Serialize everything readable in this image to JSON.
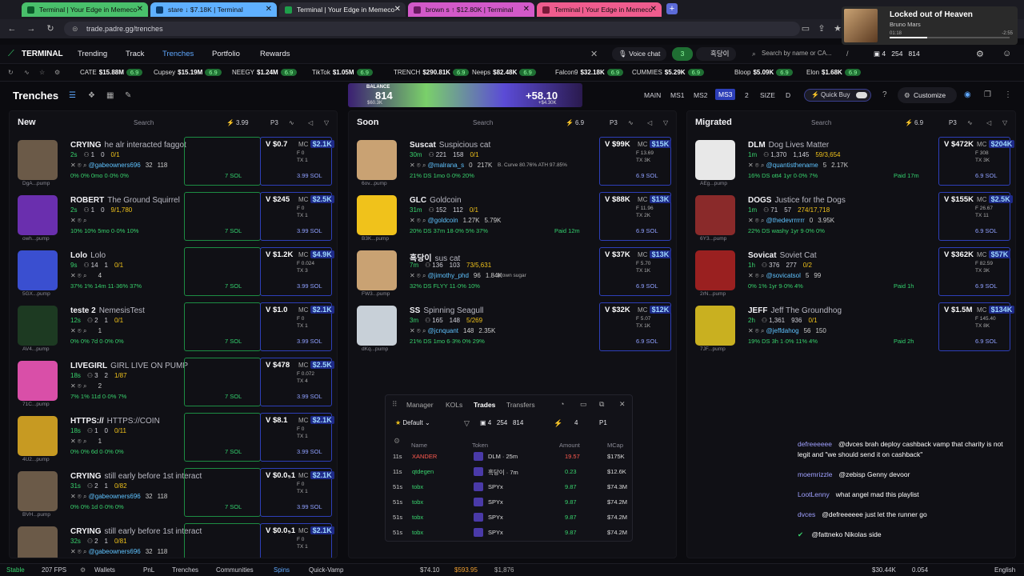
{
  "browser": {
    "tabs": [
      {
        "label": "Terminal | Your Edge in Memeco"
      },
      {
        "label": "stare ↓ $7.18K | Terminal"
      },
      {
        "label": "Terminal | Your Edge in Memeco"
      },
      {
        "label": "brown s ↑ $12.80K | Terminal"
      },
      {
        "label": "Terminal | Your Edge in Memeco"
      }
    ],
    "url": "trade.padre.gg/trenches"
  },
  "music": {
    "title": "Locked out of Heaven",
    "artist": "Bruno Mars",
    "elapsed": "01:18",
    "remaining": "-2:55"
  },
  "nav": {
    "brand": "TERMINAL",
    "links": [
      "Trending",
      "Track",
      "Trenches",
      "Portfolio",
      "Rewards"
    ],
    "voice_chat": "Voice chat",
    "badge_count": "3",
    "profile_name": "흑당이",
    "search_placeholder": "Search by name or CA...",
    "slash": "/",
    "wallet_count": "4",
    "val1": "254",
    "val2": "814"
  },
  "ticker": [
    {
      "name": "CATE",
      "mc": "$15.88M",
      "pct": "6.9"
    },
    {
      "name": "Cupsey",
      "mc": "$15.19M",
      "pct": "6.9"
    },
    {
      "name": "NEEGY",
      "mc": "$1.24M",
      "pct": "6.9"
    },
    {
      "name": "TikTok",
      "mc": "$1.05M",
      "pct": "6.9"
    },
    {
      "name": "TRENCH",
      "mc": "$290.81K",
      "pct": "6.9"
    },
    {
      "name": "Neeps",
      "mc": "$82.48K",
      "pct": "6.9"
    },
    {
      "name": "Falcon9",
      "mc": "$32.18K",
      "pct": "6.9"
    },
    {
      "name": "CUMMIES",
      "mc": "$5.29K",
      "pct": "6.9"
    },
    {
      "name": "Bloop",
      "mc": "$5.09K",
      "pct": "6.9"
    },
    {
      "name": "Elon",
      "mc": "$1.68K",
      "pct": "6.9"
    }
  ],
  "header": {
    "title": "Trenches",
    "banner_label": "BALANCE",
    "banner_value": "814",
    "banner_delta": "+58.10",
    "banner_small": "$60.3K",
    "banner_small2": "+$4.30K",
    "presets": [
      "MAIN",
      "MS1",
      "MS2",
      "MS3"
    ],
    "size_num": "2",
    "size_label": "SIZE",
    "d_label": "D",
    "quick_buy": "Quick Buy",
    "customize": "Customize"
  },
  "columns": [
    {
      "title": "New",
      "search": "Search",
      "right_val": "3.99",
      "preset": "P3",
      "cards": [
        {
          "ticker": "CRYING",
          "name": "he alr interacted faggot",
          "age": "2s",
          "holders": "1",
          "tx": "0",
          "ratio": "0/1",
          "owner": "@gabeowners696",
          "f1": "32",
          "f2": "118",
          "short": "DgA...pump",
          "vol": "V $0.7",
          "mc": "$2.1K",
          "f": "F 0",
          "tx2": "TX 1",
          "pcts": "0%   0%  0mo  0·0%  0%",
          "sol7": "7 SOL",
          "sol": "3.99 SOL",
          "thumb": "#6b5a48"
        },
        {
          "ticker": "ROBERT",
          "name": "The Ground Squirrel",
          "age": "2s",
          "holders": "1",
          "tx": "0",
          "ratio": "9/1,780",
          "owner": "",
          "f1": "",
          "f2": "",
          "short": "owh...pump",
          "vol": "V $245",
          "mc": "$2.5K",
          "f": "F 0",
          "tx2": "TX 1",
          "pcts": "10%   10%  5mo  0·0%  10%",
          "sol7": "7 SOL",
          "sol": "3.99 SOL",
          "thumb": "#6a2fae"
        },
        {
          "ticker": "Lolo",
          "name": "Lolo",
          "age": "9s",
          "holders": "14",
          "tx": "1",
          "ratio": "0/1",
          "owner": "",
          "f1": "",
          "f2": "4",
          "short": "5GX...pump",
          "vol": "V $1.2K",
          "mc": "$4.9K",
          "f": "F 0.024",
          "tx2": "TX 3",
          "pcts": "37%   1%  14m  11·36%  37%",
          "sol7": "7 SOL",
          "sol": "3.99 SOL",
          "thumb": "#3a4fd0"
        },
        {
          "ticker": "teste 2",
          "name": "NemesisTest",
          "age": "12s",
          "holders": "2",
          "tx": "1",
          "ratio": "0/1",
          "owner": "",
          "f1": "",
          "f2": "1",
          "short": "AV4...pump",
          "vol": "V $1.0",
          "mc": "$2.1K",
          "f": "F 0",
          "tx2": "TX 1",
          "pcts": "0%   0%  7d  0·0%  0%",
          "sol7": "7 SOL",
          "sol": "3.99 SOL",
          "thumb": "#1d3a22"
        },
        {
          "ticker": "LIVEGIRL",
          "name": "GIRL LIVE ON PUMP",
          "age": "18s",
          "holders": "3",
          "tx": "2",
          "ratio": "1/87",
          "owner": "",
          "f1": "",
          "f2": "2",
          "short": "71C...pump",
          "vol": "V $478",
          "mc": "$2.5K",
          "f": "F 0.072",
          "tx2": "TX 4",
          "pcts": "7%   1%  11d  0·0%  7%",
          "sol7": "7 SOL",
          "sol": "3.99 SOL",
          "thumb": "#d94fa8"
        },
        {
          "ticker": "HTTPS://",
          "name": "HTTPS://COIN",
          "age": "18s",
          "holders": "1",
          "tx": "0",
          "ratio": "0/11",
          "owner": "",
          "f1": "",
          "f2": "1",
          "short": "4U2...pump",
          "vol": "V $8.1",
          "mc": "$2.1K",
          "f": "F 0",
          "tx2": "TX 1",
          "pcts": "0%   0%  6d  0·0%  0%",
          "sol7": "7 SOL",
          "sol": "3.99 SOL",
          "thumb": "#c79a22"
        },
        {
          "ticker": "CRYING",
          "name": "still early before 1st interact",
          "age": "31s",
          "holders": "2",
          "tx": "1",
          "ratio": "0/82",
          "owner": "@gabeowners696",
          "f1": "32",
          "f2": "118",
          "short": "BVH...pump",
          "vol": "V $0.0₅1",
          "mc": "$2.1K",
          "f": "F 0",
          "tx2": "TX 1",
          "pcts": "0%   0%  1d  0·0%  0%",
          "sol7": "7 SOL",
          "sol": "3.99 SOL",
          "thumb": "#6b5a48"
        },
        {
          "ticker": "CRYING",
          "name": "still early before 1st interact",
          "age": "32s",
          "holders": "2",
          "tx": "1",
          "ratio": "0/81",
          "owner": "@gabeowners696",
          "f1": "32",
          "f2": "118",
          "short": "",
          "vol": "V $0.0₅1",
          "mc": "$2.1K",
          "f": "F 0",
          "tx2": "TX 1",
          "pcts": "",
          "sol7": "",
          "sol": "",
          "thumb": "#6b5a48"
        }
      ]
    },
    {
      "title": "Soon",
      "search": "Search",
      "right_val": "6.9",
      "preset": "P3",
      "cards": [
        {
          "ticker": "Suscat",
          "name": "Suspicious cat",
          "age": "30m",
          "holders": "221",
          "tx": "158",
          "ratio": "0/1",
          "owner": "@malrana_s",
          "f1": "0",
          "f2": "217K",
          "short": "6ov...pump",
          "vol": "V $99K",
          "mc": "$15K",
          "f": "F 13.69",
          "tx2": "TX 3K",
          "pcts": "21%  DS  1mo   0·0%  20%",
          "sol7": "",
          "sol": "6.9 SOL",
          "thumb": "#c9a273",
          "extra": "B. Curve 80.76%  ATH 97.85%"
        },
        {
          "ticker": "GLC",
          "name": "Goldcoin",
          "age": "31m",
          "holders": "152",
          "tx": "112",
          "ratio": "0/1",
          "owner": "@goldcoin",
          "f1": "1.27K",
          "f2": "5.79K",
          "short": "B3K...pump",
          "vol": "V $88K",
          "mc": "$13K",
          "f": "F 11.96",
          "tx2": "TX 2K",
          "pcts": "20%  DS  37m  18·0%  5%  37%",
          "sol7": "Paid 12m",
          "sol": "6.9 SOL",
          "thumb": "#f0c21b"
        },
        {
          "ticker": "흑당이",
          "name": "sus cat",
          "age": "7m",
          "holders": "136",
          "tx": "103",
          "ratio": "73/5,631",
          "owner": "@jimothy_phd",
          "f1": "96",
          "f2": "1.84K",
          "short": "FW3...pump",
          "vol": "V $37K",
          "mc": "$13K",
          "f": "F 5.70",
          "tx2": "TX 1K",
          "pcts": "32%  DS  FLYY  11·0%  10%",
          "sol7": "",
          "sol": "6.9 SOL",
          "thumb": "#c9a273",
          "extra": "brown sugar"
        },
        {
          "ticker": "SS",
          "name": "Spinning Seagull",
          "age": "3m",
          "holders": "165",
          "tx": "148",
          "ratio": "5/269",
          "owner": "@jcnquant",
          "f1": "148",
          "f2": "2.35K",
          "short": "dKq...pump",
          "vol": "V $32K",
          "mc": "$12K",
          "f": "F 5.07",
          "tx2": "TX 1K",
          "pcts": "21%  DS  1mo  6·3%  0%  29%",
          "sol7": "",
          "sol": "6.9 SOL",
          "thumb": "#c8d0d8"
        }
      ]
    },
    {
      "title": "Migrated",
      "search": "Search",
      "right_val": "6.9",
      "preset": "P3",
      "cards": [
        {
          "ticker": "DLM",
          "name": "Dog Lives Matter",
          "age": "1m",
          "holders": "1,370",
          "tx": "1,145",
          "ratio": "59/3,654",
          "owner": "@quantisthename",
          "f1": "5",
          "f2": "2.17K",
          "short": "AEg...pump",
          "vol": "V $472K",
          "mc": "$204K",
          "f": "F 308",
          "tx2": "TX 3K",
          "pcts": "16%  DS  ott4  1yr  0·0%  7%",
          "sol7": "Paid 17m",
          "sol": "6.9 SOL",
          "thumb": "#e8e8e8"
        },
        {
          "ticker": "DOGS",
          "name": "Justice for the Dogs",
          "age": "1m",
          "holders": "71",
          "tx": "57",
          "ratio": "274/17,718",
          "owner": "@thedevrrrrrr",
          "f1": "0",
          "f2": "3.95K",
          "short": "6Y3...pump",
          "vol": "V $155K",
          "mc": "$2.5K",
          "f": "F 26.67",
          "tx2": "TX 11",
          "pcts": "22%  DS  washy  1yr  9·0%  0%",
          "sol7": "",
          "sol": "6.9 SOL",
          "thumb": "#8a2a2a"
        },
        {
          "ticker": "Sovicat",
          "name": "Soviet Cat",
          "age": "1h",
          "holders": "376",
          "tx": "277",
          "ratio": "0/2",
          "owner": "@sovicatsol",
          "f1": "5",
          "f2": "99",
          "short": "2rN...pump",
          "vol": "V $362K",
          "mc": "$57K",
          "f": "F 82.59",
          "tx2": "TX 3K",
          "pcts": "0%  1%  1yr  9·0%  4%",
          "sol7": "Paid 1h",
          "sol": "6.9 SOL",
          "thumb": "#9a2020"
        },
        {
          "ticker": "JEFF",
          "name": "Jeff The Groundhog",
          "age": "2h",
          "holders": "1,361",
          "tx": "936",
          "ratio": "0/1",
          "owner": "@jeffdahog",
          "f1": "56",
          "f2": "150",
          "short": "7JF...pump",
          "vol": "V $1.5M",
          "mc": "$134K",
          "f": "F 145.40",
          "tx2": "TX 8K",
          "pcts": "19%  DS  3h  1·0%  11%  4%",
          "sol7": "Paid 2h",
          "sol": "6.9 SOL",
          "thumb": "#c9b020"
        }
      ]
    }
  ],
  "trades": {
    "tabs": [
      "Manager",
      "KOLs",
      "Trades",
      "Transfers"
    ],
    "preset": "Default",
    "wallets": "4",
    "v1": "254",
    "v2": "814",
    "count": "4",
    "page": "P1",
    "headers": [
      "Name",
      "Token",
      "Amount",
      "MCap"
    ],
    "rows": [
      {
        "age": "11s",
        "name": "XANDER",
        "token": "DLM · 25m",
        "amount": "19.57",
        "mcap": "$175K",
        "color": "#ff5a4f"
      },
      {
        "age": "11s",
        "name": "qtdegen",
        "token": "흑당이 · 7m",
        "amount": "0.23",
        "mcap": "$12.6K",
        "color": "#38d36d"
      },
      {
        "age": "51s",
        "name": "tobx",
        "token": "SPYx",
        "amount": "9.87",
        "mcap": "$74.3M",
        "color": "#38d36d"
      },
      {
        "age": "51s",
        "name": "tobx",
        "token": "SPYx",
        "amount": "9.87",
        "mcap": "$74.2M",
        "color": "#38d36d"
      },
      {
        "age": "51s",
        "name": "tobx",
        "token": "SPYx",
        "amount": "9.87",
        "mcap": "$74.2M",
        "color": "#38d36d"
      },
      {
        "age": "51s",
        "name": "tobx",
        "token": "SPYx",
        "amount": "9.87",
        "mcap": "$74.2M",
        "color": "#38d36d"
      }
    ]
  },
  "chat": [
    {
      "user": "defreeeeee",
      "text": "@dvces brah deploy cashback vamp that charity is not legit and \"we should send it on cashback\""
    },
    {
      "user": "moemrizzle",
      "text": "@zebisp Genny devoor"
    },
    {
      "user": "LootLenny",
      "text": "what angel mad this playlist"
    },
    {
      "user": "dvces",
      "text": "@defreeeeee just let the runner go"
    },
    {
      "user": "",
      "text": "@fattneko Nikolas side"
    }
  ],
  "footer": {
    "stable": "Stable",
    "fps": "207 FPS",
    "wallets": "Wallets",
    "pnl": "PnL",
    "trenches": "Trenches",
    "communities": "Communities",
    "spins": "Spins",
    "quick_vamp": "Quick-Vamp",
    "p1": "$74.10",
    "p2": "$593.95",
    "p3": "$1,876",
    "right1": "$30.44K",
    "right2": "0.054",
    "lang": "English"
  }
}
